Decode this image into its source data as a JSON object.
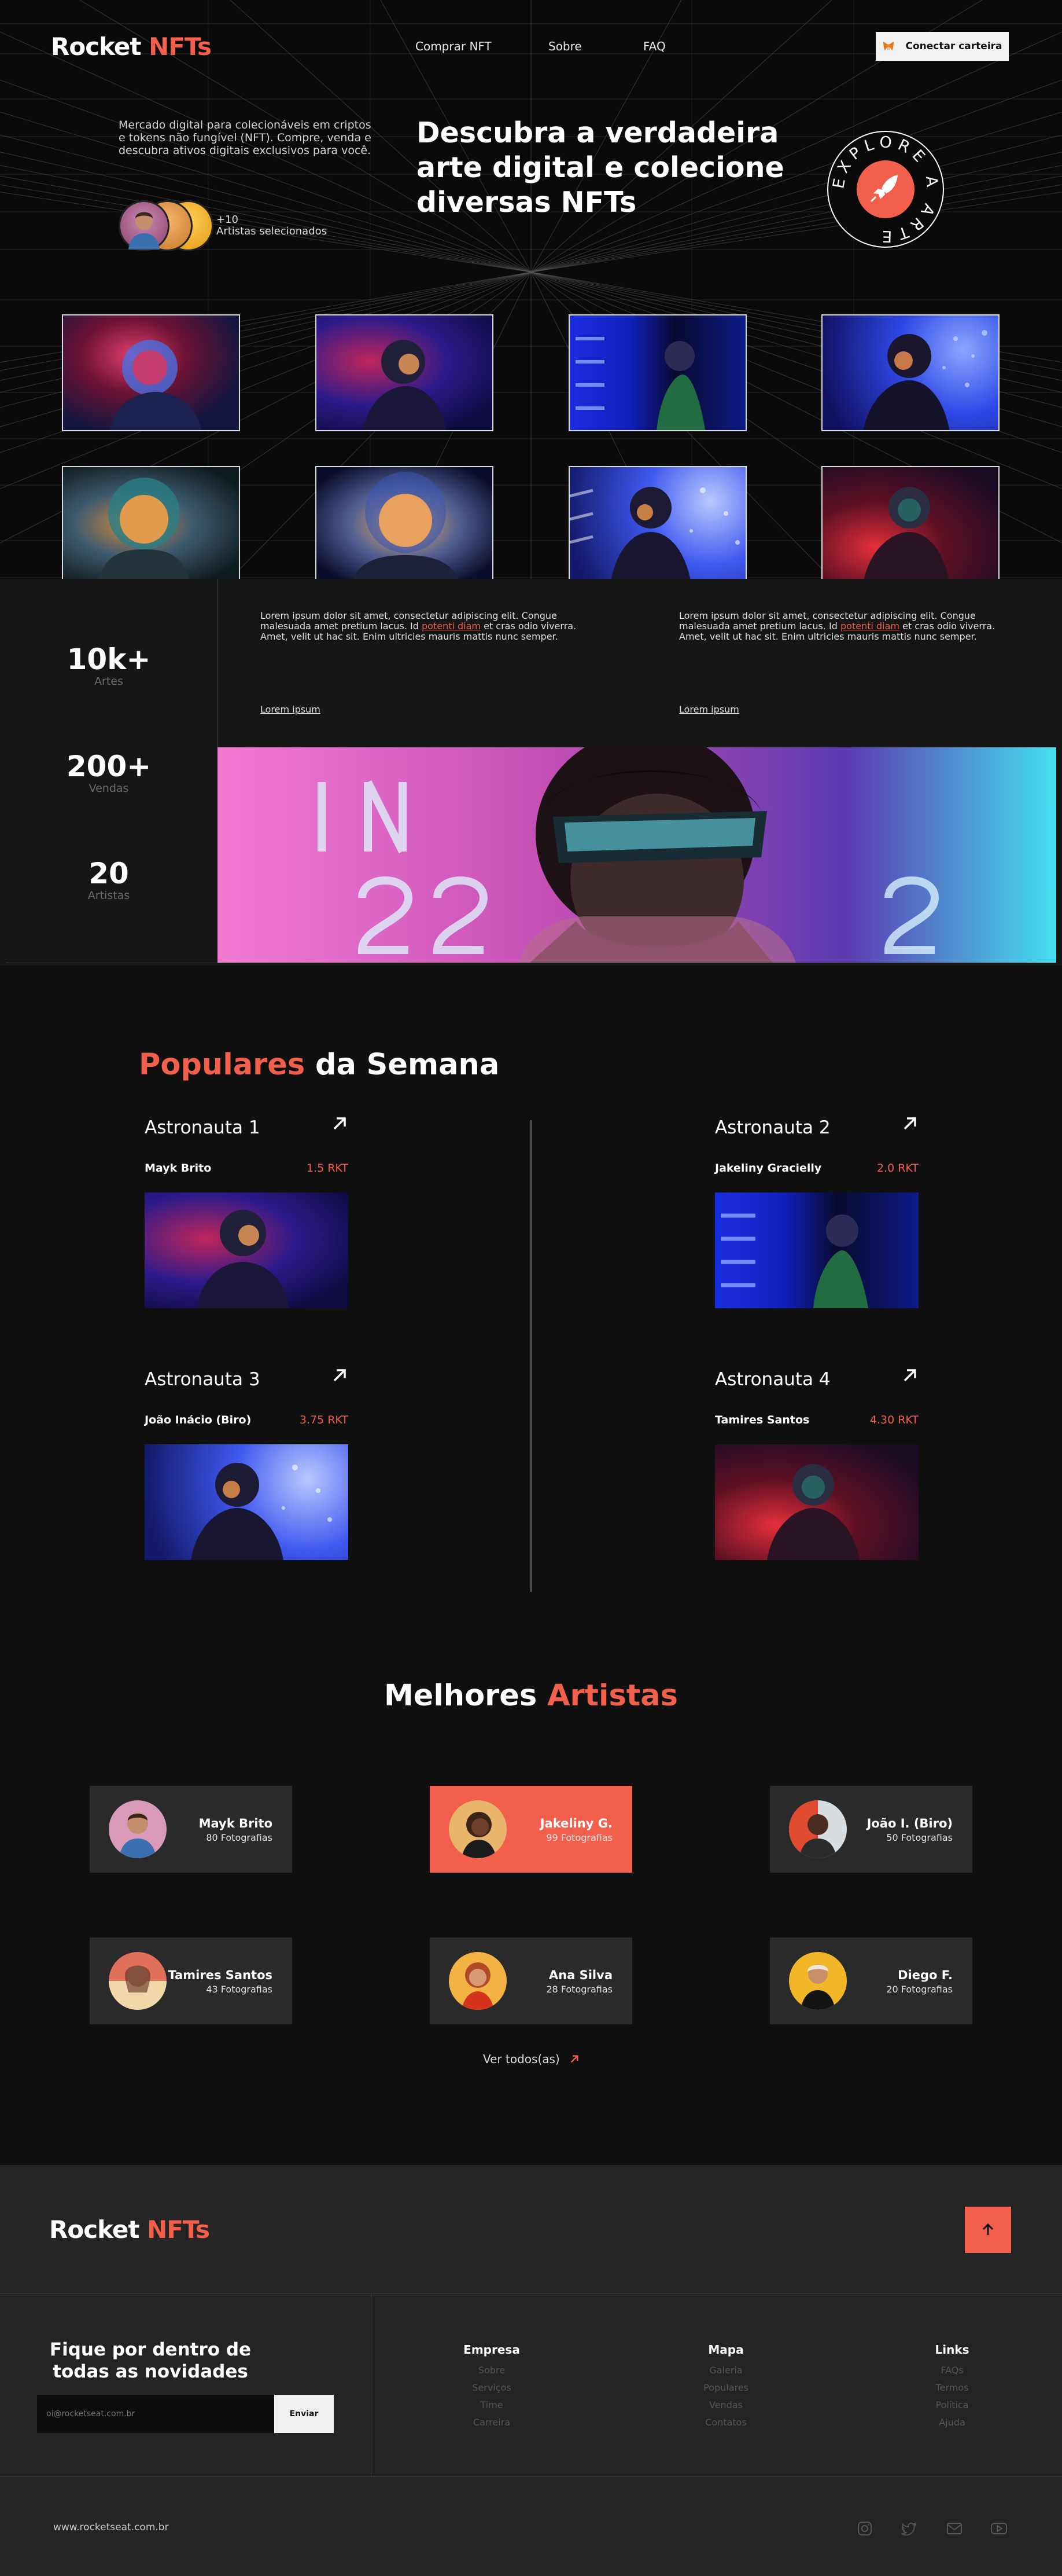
{
  "brand": {
    "name": "Rocket",
    "accent": "NFTs",
    "accent_color": "#f25f4c"
  },
  "nav": {
    "items": [
      "Comprar NFT",
      "Sobre",
      "FAQ"
    ],
    "connect_label": "Conectar carteira"
  },
  "hero": {
    "description": "Mercado digital para colecionáveis em criptos e tokens não fungível (NFT). Compre, venda e descubra ativos digitais exclusivos para você.",
    "title": "Descubra a verdadeira arte digital e colecione diversas NFTs",
    "artists_count": "+10",
    "artists_label": "Artistas selecionados",
    "badge_text": "EXPLORE A ARTE"
  },
  "stats": [
    {
      "value": "10k+",
      "label": "Artes"
    },
    {
      "value": "200+",
      "label": "Vendas"
    },
    {
      "value": "20",
      "label": "Artistas"
    }
  ],
  "lorem": {
    "before": "Lorem ipsum dolor sit amet, consectetur adipiscing elit. Congue malesuada amet pretium lacus. Id ",
    "link": "potenti diam",
    "after": " et cras odio viverra. Amet, velit ut hac sit. Enim ultricies mauris mattis nunc semper.",
    "cta": "Lorem ipsum"
  },
  "popular": {
    "title_accent": "Populares",
    "title_rest": "da Semana",
    "cards": [
      {
        "name": "Astronauta 1",
        "owner": "Mayk Brito",
        "price": "1.5 RKT"
      },
      {
        "name": "Astronauta 2",
        "owner": "Jakeliny Gracielly",
        "price": "2.0 RKT"
      },
      {
        "name": "Astronauta 3",
        "owner": "João Inácio (Biro)",
        "price": "3.75 RKT"
      },
      {
        "name": "Astronauta 4",
        "owner": "Tamires Santos",
        "price": "4.30 RKT"
      }
    ]
  },
  "best": {
    "title_rest": "Melhores",
    "title_accent": "Artistas",
    "artists": [
      {
        "name": "Mayk Brito",
        "count": "80 Fotografias"
      },
      {
        "name": "Jakeliny G.",
        "count": "99 Fotografias"
      },
      {
        "name": "João I. (Biro)",
        "count": "50 Fotografias"
      },
      {
        "name": "Tamires Santos",
        "count": "43 Fotografias"
      },
      {
        "name": "Ana Silva",
        "count": "28 Fotografias"
      },
      {
        "name": "Diego F.",
        "count": "20 Fotografias"
      }
    ],
    "view_all": "Ver todos(as)"
  },
  "footer": {
    "newsletter_title": "Fique por dentro de todas as novidades",
    "email_placeholder": "oi@rocketseat.com.br",
    "send_label": "Enviar",
    "columns": [
      {
        "title": "Empresa",
        "items": [
          "Sobre",
          "Serviços",
          "Time",
          "Carreira"
        ]
      },
      {
        "title": "Mapa",
        "items": [
          "Galeria",
          "Populares",
          "Vendas",
          "Contatos"
        ]
      },
      {
        "title": "Links",
        "items": [
          "FAQs",
          "Termos",
          "Política",
          "Ajuda"
        ]
      }
    ],
    "site": "www.rocketseat.com.br",
    "social_icons": [
      "instagram-icon",
      "twitter-icon",
      "mail-icon",
      "youtube-icon"
    ]
  }
}
